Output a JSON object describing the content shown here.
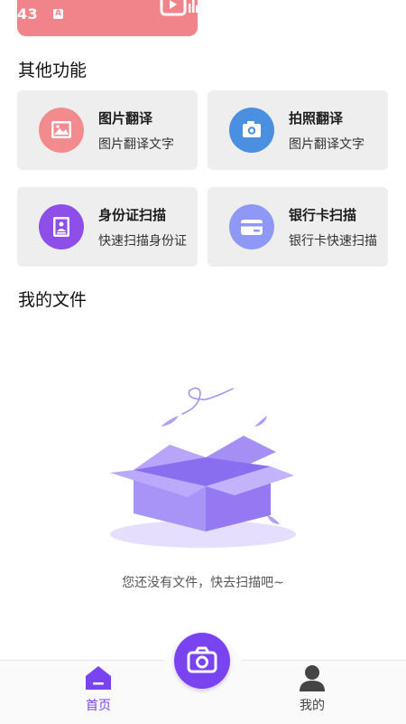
{
  "status_bar": {
    "time": "43",
    "badge": "A"
  },
  "sections": {
    "other_functions_title": "其他功能",
    "my_files_title": "我的文件"
  },
  "cards": [
    {
      "title": "图片翻译",
      "subtitle": "图片翻译文字",
      "icon": "image-icon",
      "color": "#f38b8e"
    },
    {
      "title": "拍照翻译",
      "subtitle": "图片翻译文字",
      "icon": "camera-icon",
      "color": "#4a8fe0"
    },
    {
      "title": "身份证扫描",
      "subtitle": "快速扫描身份证",
      "icon": "id-card-icon",
      "color": "#8d4fe8"
    },
    {
      "title": "银行卡扫描",
      "subtitle": "银行卡快速扫描",
      "icon": "bank-card-icon",
      "color": "#8f98f4"
    }
  ],
  "empty_state": {
    "message": "您还没有文件，快去扫描吧~",
    "illustration": "empty-box-illustration"
  },
  "bottom_nav": {
    "home_label": "首页",
    "mine_label": "我的",
    "active_color": "#7a43f0",
    "inactive_color": "#444444"
  }
}
